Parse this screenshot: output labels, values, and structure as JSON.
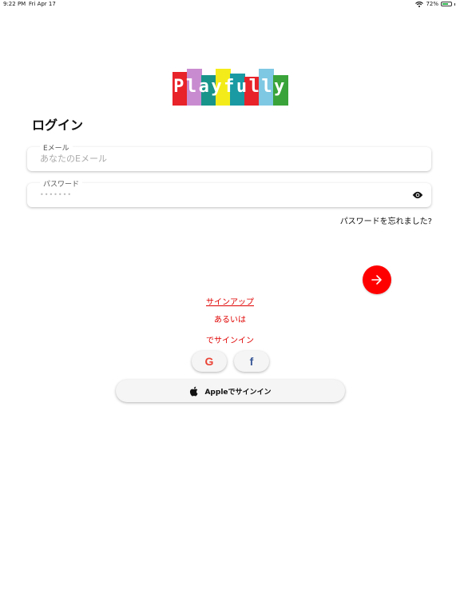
{
  "status_bar": {
    "time": "9:22 PM",
    "date": "Fri Apr 17",
    "battery": "72%",
    "battery_level": 0.72
  },
  "logo": {
    "text": "Playfully",
    "colors": [
      "#e8232a",
      "#c98bd0",
      "#18948a",
      "#f4ec1a",
      "#1a9aa3",
      "#e8232a",
      "#7ec8e3",
      "#3aa43a"
    ]
  },
  "title": "ログイン",
  "email": {
    "label": "Eメール",
    "placeholder": "あなたのEメール"
  },
  "password": {
    "label": "パスワード",
    "value": "•••••••"
  },
  "forgot_password": "パスワードを忘れました?",
  "signup": "サインアップ",
  "or": "あるいは",
  "signin_with": "でサインイン",
  "apple_button": "Appleでサインイン",
  "accent_color": "#ff0000"
}
